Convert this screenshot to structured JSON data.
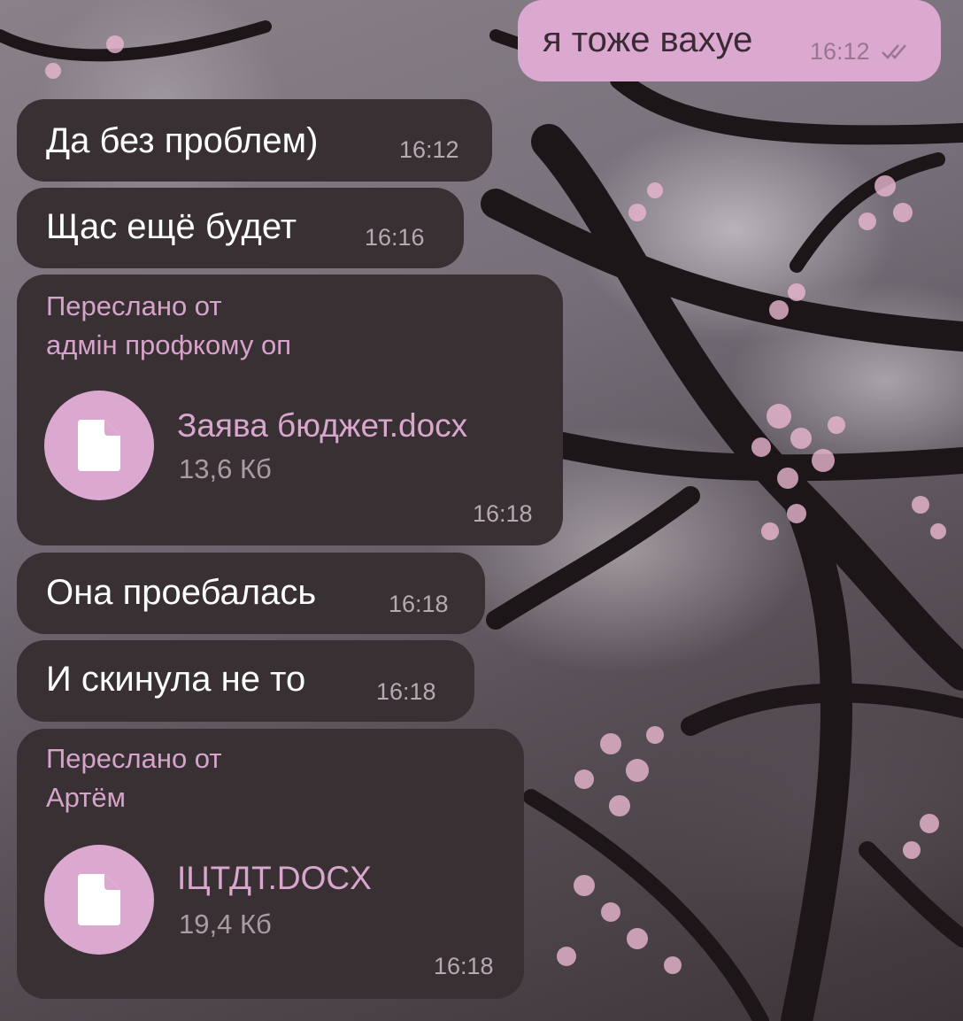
{
  "messages": [
    {
      "text": "я тоже вахуе",
      "time": "16:12",
      "status_icon": "double-check-icon"
    },
    {
      "text": "Да без проблем)",
      "time": "16:12"
    },
    {
      "text": "Щас ещё будет",
      "time": "16:16"
    },
    {
      "forwarded_label": "Переслано от",
      "forwarded_from": "адмін профкому оп",
      "file": {
        "name": "Заява бюджет.docx",
        "size": "13,6 Кб",
        "icon": "document-icon"
      },
      "time": "16:18"
    },
    {
      "text": "Она проебалась",
      "time": "16:18"
    },
    {
      "text": "И скинула не то",
      "time": "16:18"
    },
    {
      "forwarded_label": "Переслано от",
      "forwarded_from": "Артём",
      "file": {
        "name": "ІЦТДТ.DOCX",
        "size": "19,4 Кб",
        "icon": "document-icon"
      },
      "time": "16:18"
    }
  ],
  "colors": {
    "incoming_bubble": "#393034",
    "outgoing_bubble": "#dba9cf",
    "accent_pink": "#d6a4cb"
  }
}
